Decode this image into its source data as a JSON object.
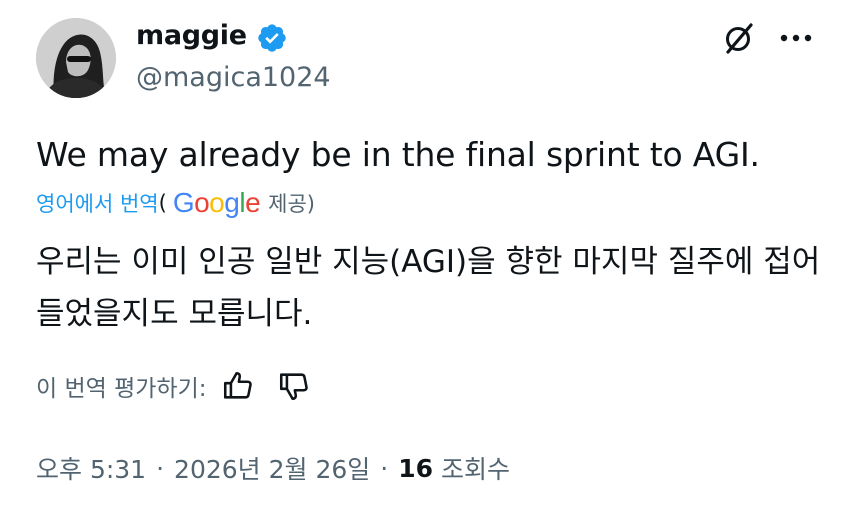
{
  "author": {
    "display_name": "maggie",
    "handle": "@magica1024",
    "verified": true
  },
  "tweet": {
    "text": "We may already be in the final sprint to AGI."
  },
  "translation": {
    "link_label": "영어에서 번역",
    "open_paren": "(",
    "google_label": "Google",
    "google_colors": [
      "#4285F4",
      "#EA4335",
      "#FBBC05",
      "#4285F4",
      "#34A853",
      "#EA4335"
    ],
    "provided_label": "제공)",
    "translated_text": "우리는 이미 인공 일반 지능(AGI)을 향한 마지막 질주에 접어들었을지도 모릅니다."
  },
  "rating": {
    "label": "이 번역 평가하기:",
    "icons": [
      "thumbs-up-icon",
      "thumbs-down-icon"
    ]
  },
  "meta": {
    "time": "오후 5:31",
    "separator": "·",
    "date": "2026년 2월 26일",
    "views_count": "16",
    "views_label": "조회수"
  },
  "colors": {
    "text": "#0f1419",
    "muted": "#536471",
    "link": "#1d9bf0",
    "verified": "#1d9bf0"
  }
}
